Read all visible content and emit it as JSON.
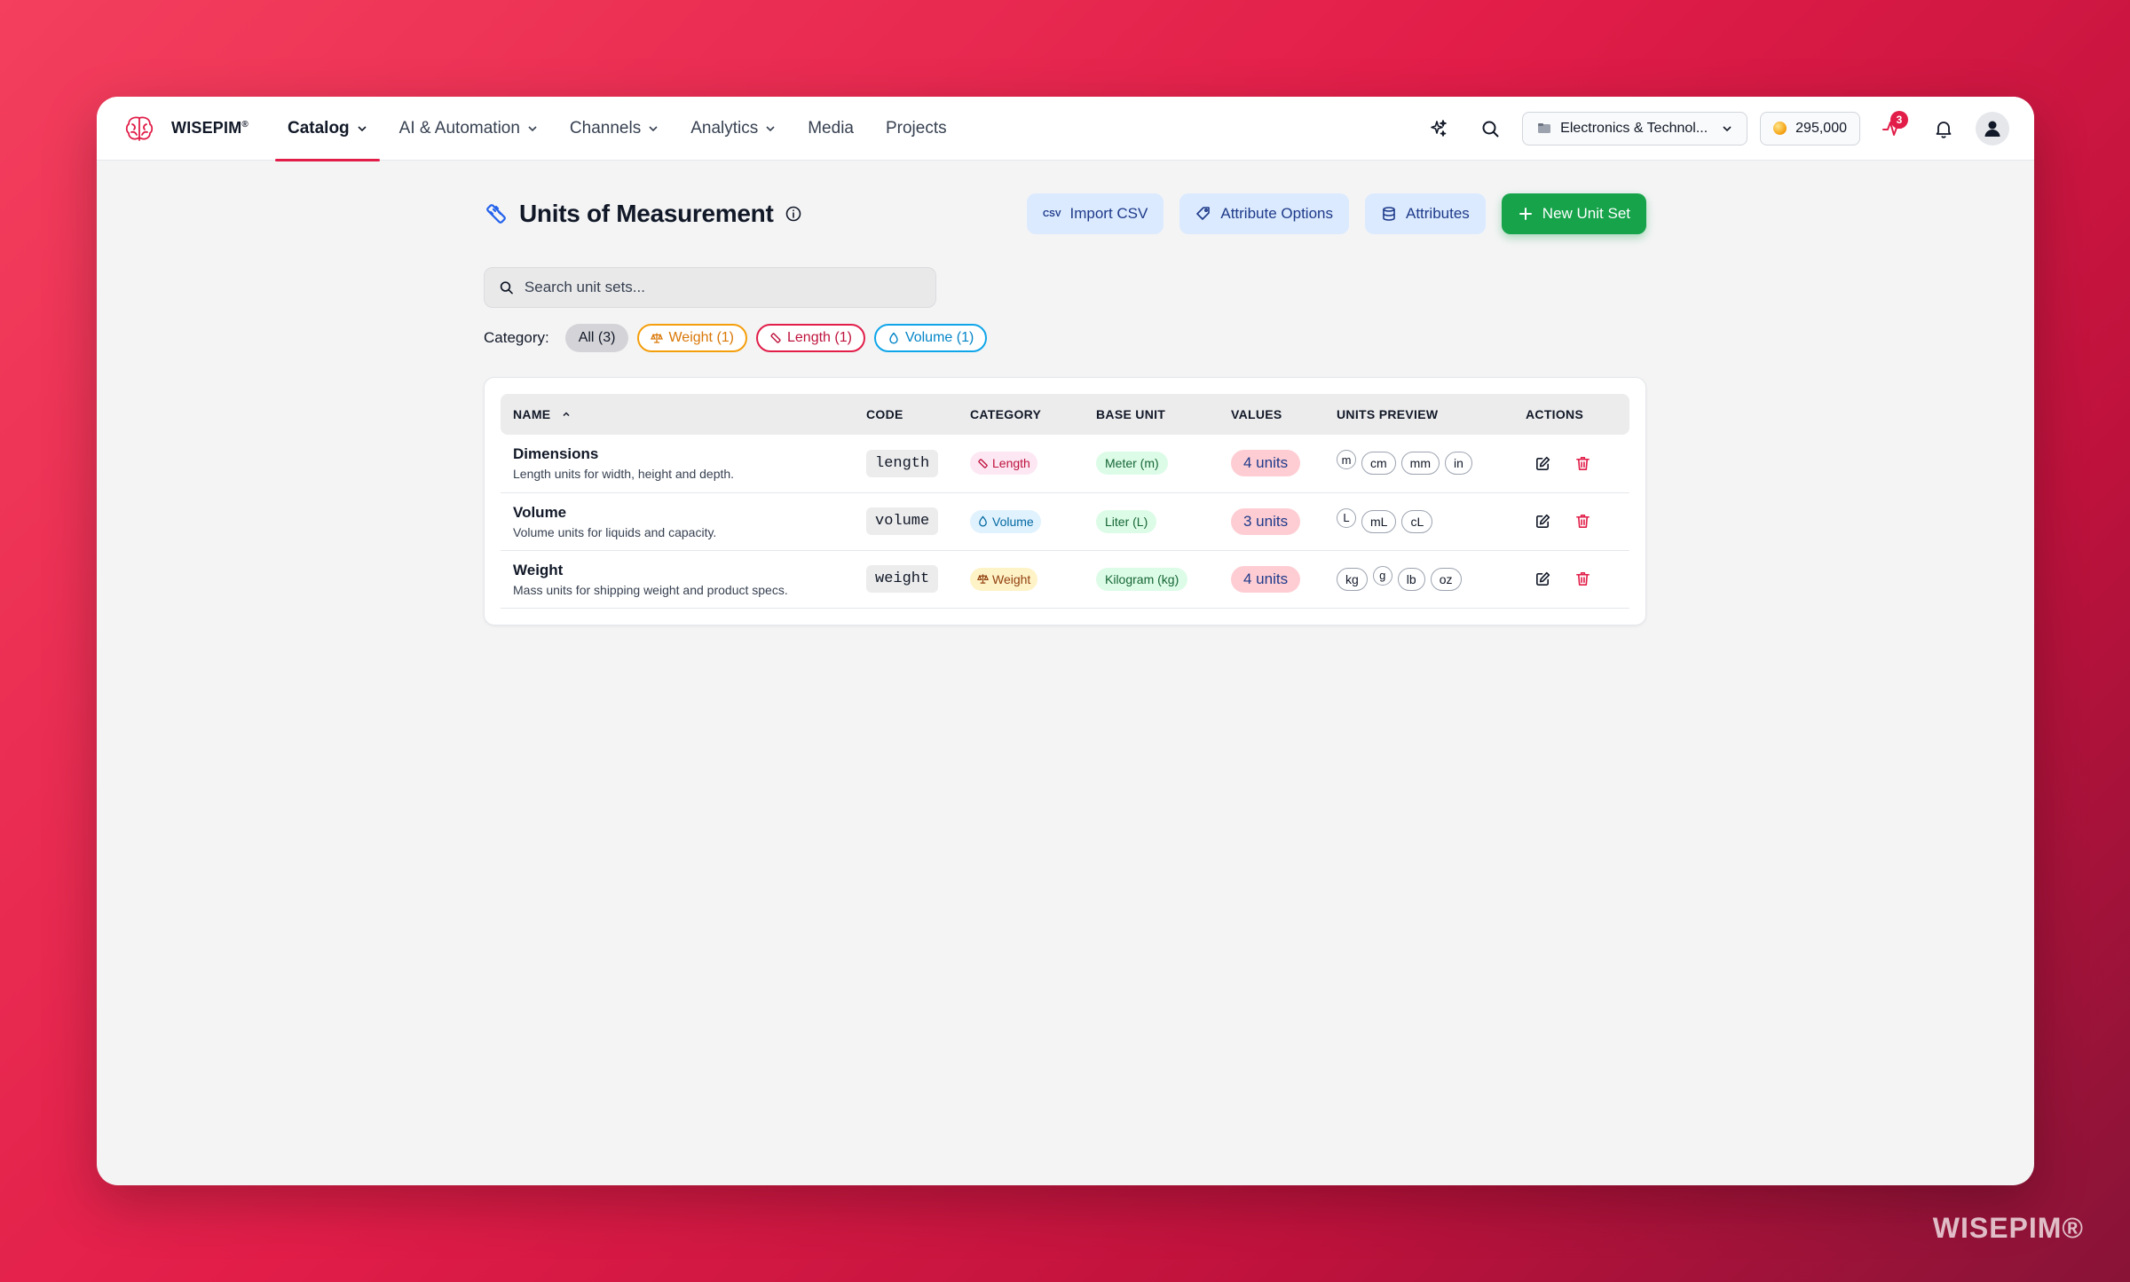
{
  "brand": {
    "name": "WISEPIM",
    "reg": "®",
    "watermark": "WISEPIM®"
  },
  "nav": {
    "items": [
      {
        "label": "Catalog",
        "dropdown": true,
        "active": true
      },
      {
        "label": "AI & Automation",
        "dropdown": true
      },
      {
        "label": "Channels",
        "dropdown": true
      },
      {
        "label": "Analytics",
        "dropdown": true
      },
      {
        "label": "Media",
        "dropdown": false
      },
      {
        "label": "Projects",
        "dropdown": false
      }
    ],
    "workspace": "Electronics & Technol...",
    "credits": "295,000",
    "activity_badge": "3"
  },
  "page": {
    "title": "Units of Measurement",
    "buttons": {
      "import_csv": "Import CSV",
      "csv_icon_text": "CSV",
      "attribute_options": "Attribute Options",
      "attributes": "Attributes",
      "new_unit_set": "New Unit Set"
    },
    "search_placeholder": "Search unit sets...",
    "filter_label": "Category:",
    "filters": {
      "all": "All (3)",
      "weight": "Weight (1)",
      "length": "Length (1)",
      "volume": "Volume (1)"
    }
  },
  "table": {
    "headers": {
      "name": "NAME",
      "code": "CODE",
      "category": "CATEGORY",
      "base_unit": "BASE UNIT",
      "values": "VALUES",
      "units_preview": "UNITS PREVIEW",
      "actions": "ACTIONS"
    },
    "rows": [
      {
        "name": "Dimensions",
        "description": "Length units for width, height and depth.",
        "code": "length",
        "category": "Length",
        "base_unit": "Meter (m)",
        "values": "4 units",
        "units": [
          "m",
          "cm",
          "mm",
          "in"
        ]
      },
      {
        "name": "Volume",
        "description": "Volume units for liquids and capacity.",
        "code": "volume",
        "category": "Volume",
        "base_unit": "Liter (L)",
        "values": "3 units",
        "units": [
          "L",
          "mL",
          "cL"
        ]
      },
      {
        "name": "Weight",
        "description": "Mass units for shipping weight and product specs.",
        "code": "weight",
        "category": "Weight",
        "base_unit": "Kilogram (kg)",
        "values": "4 units",
        "units": [
          "kg",
          "g",
          "lb",
          "oz"
        ]
      }
    ]
  },
  "colors": {
    "accent": "#e11d48",
    "primary_button": "#16a34a",
    "soft_button": "#dbeafe",
    "values_badge": "#fecdd3"
  }
}
